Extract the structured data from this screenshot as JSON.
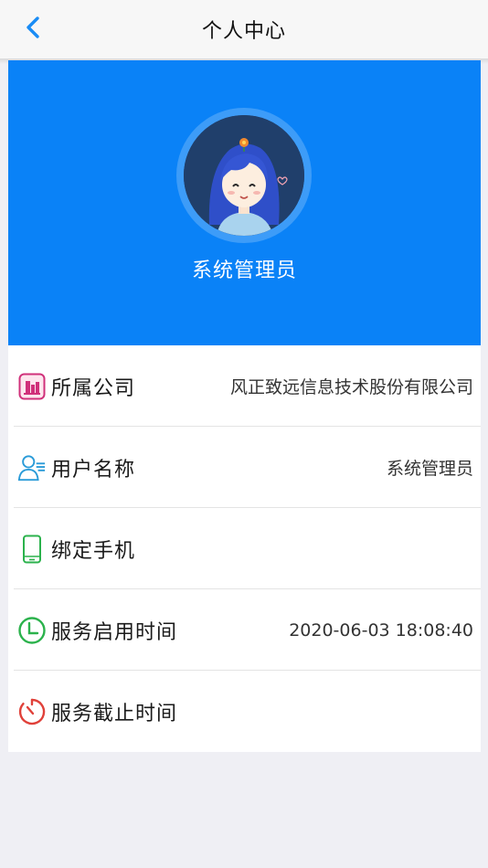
{
  "navbar": {
    "title": "个人中心",
    "back_icon": "chevron-left-icon"
  },
  "profile": {
    "name": "系统管理员",
    "avatar": "avatar-girl-illustration"
  },
  "colors": {
    "accent": "#0a82f7",
    "company_icon": "#d0307a",
    "user_icon": "#2a9bd8",
    "phone_icon": "#2bb24c",
    "start_icon": "#2bb24c",
    "end_icon": "#e0413a"
  },
  "rows": [
    {
      "label": "所属公司",
      "value": "风正致远信息技术股份有限公司",
      "icon": "company-building-icon"
    },
    {
      "label": "用户名称",
      "value": "系统管理员",
      "icon": "user-profile-icon"
    },
    {
      "label": "绑定手机",
      "value": "",
      "icon": "mobile-phone-icon"
    },
    {
      "label": "服务启用时间",
      "value": "2020-06-03 18:08:40",
      "icon": "clock-icon"
    },
    {
      "label": "服务截止时间",
      "value": "",
      "icon": "timer-icon"
    }
  ]
}
